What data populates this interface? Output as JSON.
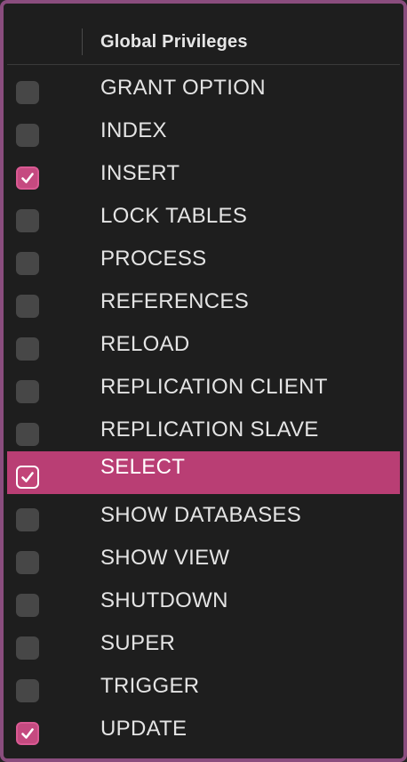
{
  "header": {
    "title": "Global Privileges"
  },
  "colors": {
    "accent": "#b93e74",
    "checkbox_checked": "#c54a80",
    "frame_border": "#8a4d7e",
    "background": "#1e1e1e"
  },
  "privileges": [
    {
      "label": "GRANT OPTION",
      "checked": false,
      "selected": false
    },
    {
      "label": "INDEX",
      "checked": false,
      "selected": false
    },
    {
      "label": "INSERT",
      "checked": true,
      "selected": false
    },
    {
      "label": "LOCK TABLES",
      "checked": false,
      "selected": false
    },
    {
      "label": "PROCESS",
      "checked": false,
      "selected": false
    },
    {
      "label": "REFERENCES",
      "checked": false,
      "selected": false
    },
    {
      "label": "RELOAD",
      "checked": false,
      "selected": false
    },
    {
      "label": "REPLICATION CLIENT",
      "checked": false,
      "selected": false
    },
    {
      "label": "REPLICATION SLAVE",
      "checked": false,
      "selected": false
    },
    {
      "label": "SELECT",
      "checked": true,
      "selected": true
    },
    {
      "label": "SHOW DATABASES",
      "checked": false,
      "selected": false
    },
    {
      "label": "SHOW VIEW",
      "checked": false,
      "selected": false
    },
    {
      "label": "SHUTDOWN",
      "checked": false,
      "selected": false
    },
    {
      "label": "SUPER",
      "checked": false,
      "selected": false
    },
    {
      "label": "TRIGGER",
      "checked": false,
      "selected": false
    },
    {
      "label": "UPDATE",
      "checked": true,
      "selected": false
    }
  ]
}
